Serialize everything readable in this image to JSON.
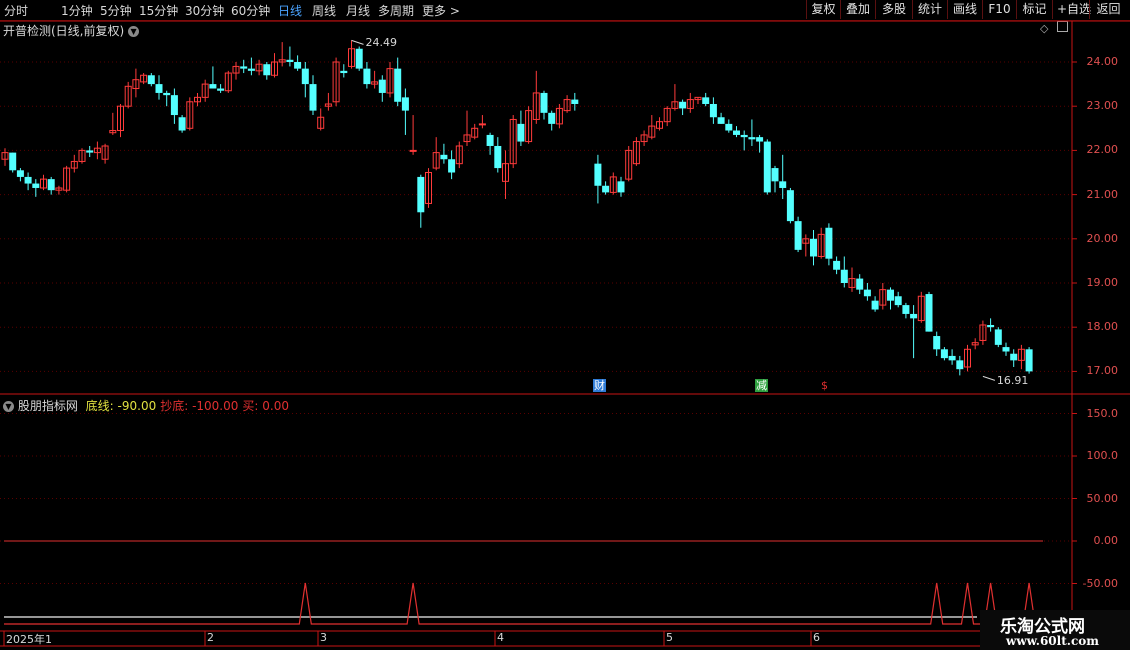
{
  "toolbar": {
    "periods": [
      "分时",
      "1分钟",
      "5分钟",
      "15分钟",
      "30分钟",
      "60分钟",
      "日线",
      "周线",
      "月线",
      "多周期",
      "更多 >"
    ],
    "active_period": "日线",
    "buttons": [
      "复权",
      "叠加",
      "多股",
      "统计",
      "画线",
      "F10",
      "标记",
      "+自选",
      "返回"
    ]
  },
  "main": {
    "title": "开普检测(日线,前复权)",
    "high_label": "24.49",
    "low_label": "16.91",
    "y_labels": [
      "24.00",
      "23.00",
      "22.00",
      "21.00",
      "20.00",
      "19.00",
      "18.00",
      "17.00"
    ],
    "markers": [
      {
        "text": "财",
        "color": "#2f7bd6"
      },
      {
        "text": "减",
        "color": "#2fa040"
      },
      {
        "text": "$",
        "color": "#e03030"
      }
    ]
  },
  "indicator": {
    "name": "股朋指标网",
    "legend": [
      {
        "label": "底线:",
        "value": "-90.00",
        "color": "#e0e040"
      },
      {
        "label": "抄底:",
        "value": "-100.00",
        "color": "#e03030"
      },
      {
        "label": "买:",
        "value": "0.00",
        "color": "#e03030"
      }
    ],
    "y_labels": [
      "150.0",
      "100.0",
      "50.00",
      "0.00",
      "-50.00"
    ]
  },
  "date_axis": [
    "2025年1",
    "2",
    "3",
    "4",
    "5",
    "6"
  ],
  "watermark": {
    "name": "乐淘公式网",
    "url": "www.60lt.com"
  },
  "colors": {
    "up": "#ff3b3b",
    "down": "#54ffff",
    "grid": "#5a0000",
    "axis": "#c81414"
  },
  "chart_data": {
    "type": "candlestick",
    "ylim": [
      16.6,
      24.9
    ],
    "candles": [
      [
        21.8,
        22.05,
        21.65,
        21.95
      ],
      [
        21.95,
        21.95,
        21.5,
        21.55
      ],
      [
        21.55,
        21.6,
        21.3,
        21.4
      ],
      [
        21.4,
        21.5,
        21.1,
        21.25
      ],
      [
        21.25,
        21.35,
        20.95,
        21.15
      ],
      [
        21.15,
        21.45,
        21.1,
        21.35
      ],
      [
        21.35,
        21.4,
        21.0,
        21.1
      ],
      [
        21.1,
        21.2,
        21.0,
        21.15
      ],
      [
        21.1,
        21.65,
        21.05,
        21.6
      ],
      [
        21.6,
        21.9,
        21.5,
        21.75
      ],
      [
        21.75,
        22.05,
        21.7,
        22.0
      ],
      [
        22.0,
        22.1,
        21.85,
        21.95
      ],
      [
        21.95,
        22.2,
        21.8,
        22.05
      ],
      [
        21.8,
        22.15,
        21.7,
        22.1
      ],
      [
        22.4,
        22.85,
        22.35,
        22.45
      ],
      [
        22.45,
        23.05,
        22.3,
        23.0
      ],
      [
        23.0,
        23.55,
        22.95,
        23.45
      ],
      [
        23.4,
        23.85,
        23.2,
        23.6
      ],
      [
        23.55,
        23.75,
        23.5,
        23.7
      ],
      [
        23.7,
        23.75,
        23.45,
        23.5
      ],
      [
        23.5,
        23.7,
        23.15,
        23.3
      ],
      [
        23.3,
        23.35,
        23.0,
        23.25
      ],
      [
        23.25,
        23.4,
        22.6,
        22.8
      ],
      [
        22.75,
        22.8,
        22.4,
        22.45
      ],
      [
        22.5,
        23.2,
        22.45,
        23.1
      ],
      [
        23.1,
        23.3,
        23.0,
        23.2
      ],
      [
        23.2,
        23.6,
        23.1,
        23.5
      ],
      [
        23.5,
        23.9,
        23.4,
        23.4
      ],
      [
        23.4,
        23.5,
        23.3,
        23.35
      ],
      [
        23.35,
        23.8,
        23.3,
        23.75
      ],
      [
        23.75,
        24.0,
        23.6,
        23.9
      ],
      [
        23.9,
        24.05,
        23.75,
        23.85
      ],
      [
        23.85,
        24.1,
        23.7,
        23.8
      ],
      [
        23.8,
        24.05,
        23.7,
        23.95
      ],
      [
        23.95,
        24.0,
        23.6,
        23.7
      ],
      [
        23.7,
        24.2,
        23.65,
        24.0
      ],
      [
        24.0,
        24.45,
        23.9,
        24.05
      ],
      [
        24.05,
        24.35,
        23.9,
        24.0
      ],
      [
        24.0,
        24.15,
        23.8,
        23.85
      ],
      [
        23.85,
        24.0,
        23.2,
        23.5
      ],
      [
        23.5,
        23.7,
        22.8,
        22.9
      ],
      [
        22.5,
        22.95,
        22.45,
        22.75
      ],
      [
        23.0,
        23.3,
        22.9,
        23.05
      ],
      [
        23.1,
        24.1,
        23.0,
        24.0
      ],
      [
        23.8,
        23.95,
        23.65,
        23.75
      ],
      [
        23.9,
        24.49,
        23.85,
        24.3
      ],
      [
        24.3,
        24.35,
        23.8,
        23.85
      ],
      [
        23.85,
        24.0,
        23.4,
        23.5
      ],
      [
        23.5,
        23.8,
        23.4,
        23.55
      ],
      [
        23.6,
        23.7,
        23.1,
        23.3
      ],
      [
        23.3,
        24.0,
        23.2,
        23.85
      ],
      [
        23.85,
        24.1,
        23.0,
        23.1
      ],
      [
        23.2,
        23.4,
        22.35,
        22.9
      ],
      [
        22.0,
        22.8,
        21.9,
        22.0
      ],
      [
        21.4,
        21.45,
        20.25,
        20.6
      ],
      [
        20.8,
        21.6,
        20.7,
        21.5
      ],
      [
        21.6,
        22.3,
        21.55,
        21.95
      ],
      [
        21.9,
        22.15,
        21.7,
        21.8
      ],
      [
        21.8,
        22.0,
        21.35,
        21.5
      ],
      [
        21.7,
        22.2,
        21.6,
        22.1
      ],
      [
        22.2,
        22.9,
        22.1,
        22.35
      ],
      [
        22.3,
        22.6,
        22.25,
        22.5
      ],
      [
        22.6,
        22.8,
        22.5,
        22.6
      ],
      [
        22.35,
        22.4,
        21.9,
        22.1
      ],
      [
        22.1,
        22.3,
        21.5,
        21.6
      ],
      [
        21.3,
        22.0,
        20.9,
        21.7
      ],
      [
        21.7,
        22.8,
        21.6,
        22.7
      ],
      [
        22.6,
        22.9,
        22.1,
        22.2
      ],
      [
        22.2,
        23.0,
        22.15,
        22.9
      ],
      [
        22.7,
        23.8,
        22.6,
        23.3
      ],
      [
        23.3,
        23.35,
        22.7,
        22.85
      ],
      [
        22.85,
        22.9,
        22.45,
        22.6
      ],
      [
        22.6,
        23.05,
        22.5,
        22.95
      ],
      [
        22.9,
        23.25,
        22.85,
        23.15
      ],
      [
        23.15,
        23.3,
        22.9,
        23.05
      ],
      null,
      null,
      [
        21.7,
        21.9,
        20.8,
        21.2
      ],
      [
        21.2,
        21.3,
        21.0,
        21.05
      ],
      [
        21.05,
        21.5,
        21.0,
        21.4
      ],
      [
        21.3,
        21.4,
        20.95,
        21.05
      ],
      [
        21.35,
        22.1,
        21.3,
        22.0
      ],
      [
        21.7,
        22.3,
        21.65,
        22.2
      ],
      [
        22.2,
        22.45,
        22.1,
        22.35
      ],
      [
        22.3,
        22.8,
        22.25,
        22.55
      ],
      [
        22.5,
        22.75,
        22.45,
        22.65
      ],
      [
        22.65,
        23.0,
        22.55,
        22.95
      ],
      [
        22.95,
        23.5,
        22.9,
        23.1
      ],
      [
        23.1,
        23.15,
        22.8,
        22.95
      ],
      [
        22.95,
        23.3,
        22.85,
        23.15
      ],
      [
        23.15,
        23.2,
        23.05,
        23.2
      ],
      [
        23.2,
        23.3,
        23.0,
        23.05
      ],
      [
        23.05,
        23.2,
        22.6,
        22.75
      ],
      [
        22.75,
        22.85,
        22.6,
        22.6
      ],
      [
        22.6,
        22.7,
        22.4,
        22.45
      ],
      [
        22.45,
        22.55,
        22.3,
        22.35
      ],
      [
        22.35,
        22.45,
        22.0,
        22.3
      ],
      [
        22.3,
        22.7,
        22.1,
        22.25
      ],
      [
        22.3,
        22.35,
        21.95,
        22.2
      ],
      [
        22.2,
        22.25,
        21.0,
        21.05
      ],
      [
        21.6,
        21.65,
        21.05,
        21.3
      ],
      [
        21.3,
        21.9,
        20.9,
        21.15
      ],
      [
        21.1,
        21.15,
        20.35,
        20.4
      ],
      [
        20.4,
        20.5,
        19.7,
        19.75
      ],
      [
        19.9,
        20.1,
        19.6,
        20.0
      ],
      [
        20.0,
        20.2,
        19.4,
        19.6
      ],
      [
        19.6,
        20.25,
        19.55,
        20.1
      ],
      [
        20.25,
        20.35,
        19.4,
        19.55
      ],
      [
        19.5,
        19.6,
        19.2,
        19.3
      ],
      [
        19.3,
        19.6,
        18.9,
        19.0
      ],
      [
        18.9,
        19.35,
        18.8,
        19.1
      ],
      [
        19.1,
        19.2,
        18.75,
        18.85
      ],
      [
        18.85,
        19.0,
        18.6,
        18.7
      ],
      [
        18.6,
        18.7,
        18.35,
        18.4
      ],
      [
        18.5,
        19.0,
        18.4,
        18.85
      ],
      [
        18.85,
        18.9,
        18.4,
        18.6
      ],
      [
        18.7,
        18.8,
        18.45,
        18.5
      ],
      [
        18.5,
        18.55,
        18.2,
        18.3
      ],
      [
        18.3,
        18.5,
        17.3,
        18.2
      ],
      [
        18.15,
        18.8,
        18.1,
        18.7
      ],
      [
        18.75,
        18.8,
        17.9,
        17.9
      ],
      [
        17.8,
        17.9,
        17.35,
        17.5
      ],
      [
        17.5,
        17.55,
        17.25,
        17.3
      ],
      [
        17.35,
        17.5,
        17.15,
        17.25
      ],
      [
        17.25,
        17.35,
        16.91,
        17.05
      ],
      [
        17.1,
        17.6,
        17.0,
        17.5
      ],
      [
        17.6,
        17.75,
        17.5,
        17.65
      ],
      [
        17.7,
        18.15,
        17.6,
        18.05
      ],
      [
        18.05,
        18.2,
        17.9,
        18.0
      ],
      [
        17.95,
        18.0,
        17.55,
        17.6
      ],
      [
        17.55,
        17.65,
        17.35,
        17.45
      ],
      [
        17.4,
        17.5,
        17.1,
        17.25
      ],
      [
        17.25,
        17.6,
        17.05,
        17.5
      ],
      [
        17.5,
        17.55,
        16.95,
        17.0
      ]
    ],
    "indicator_peaks_index": [
      39,
      53,
      121,
      125,
      128,
      133
    ],
    "indicator_ylim": [
      -90,
      175
    ]
  }
}
